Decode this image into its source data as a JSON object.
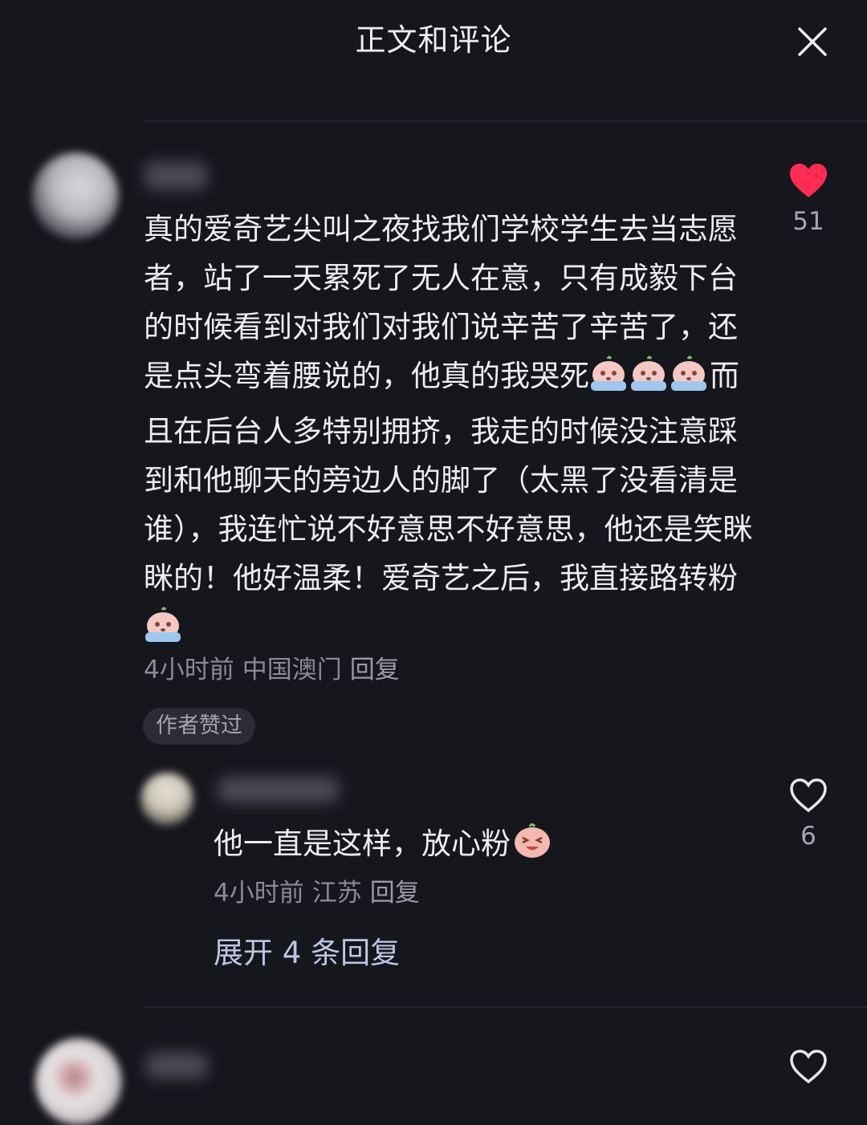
{
  "header": {
    "title": "正文和评论",
    "close_icon": "close-icon"
  },
  "colors": {
    "background": "#16161d",
    "text": "#ecedf0",
    "muted": "#8a8b95",
    "like_red": "#fe2c55",
    "link": "#bcc6e4"
  },
  "comment": {
    "text": "真的爱奇艺尖叫之夜找我们学校学生去当志愿者，站了一天累死了无人在意，只有成毅下台的时候看到对我们对我们说辛苦了辛苦了，还是点头弯着腰说的，他真的我哭死",
    "text_after_emoji": "而且在后台人多特别拥挤，我走的时候没注意踩到和他聊天的旁边人的脚了（太黑了没看清是谁），我连忙说不好意思不好意思，他还是笑眯眯的！他好温柔！爱奇艺之后，我直接路转粉",
    "emoji_icon": "crying-emoji-icon",
    "time": "4小时前",
    "location": "中国澳门",
    "reply_label": "回复",
    "author_badge": "作者赞过",
    "likes": "51",
    "liked": true
  },
  "reply": {
    "text": "他一直是这样，放心粉",
    "emoji_icon": "laughing-emoji-icon",
    "time": "4小时前",
    "location": "江苏",
    "reply_label": "回复",
    "likes": "6",
    "liked": false
  },
  "expand_replies_label": "展开 4 条回复",
  "next_comment": {
    "liked": false
  }
}
